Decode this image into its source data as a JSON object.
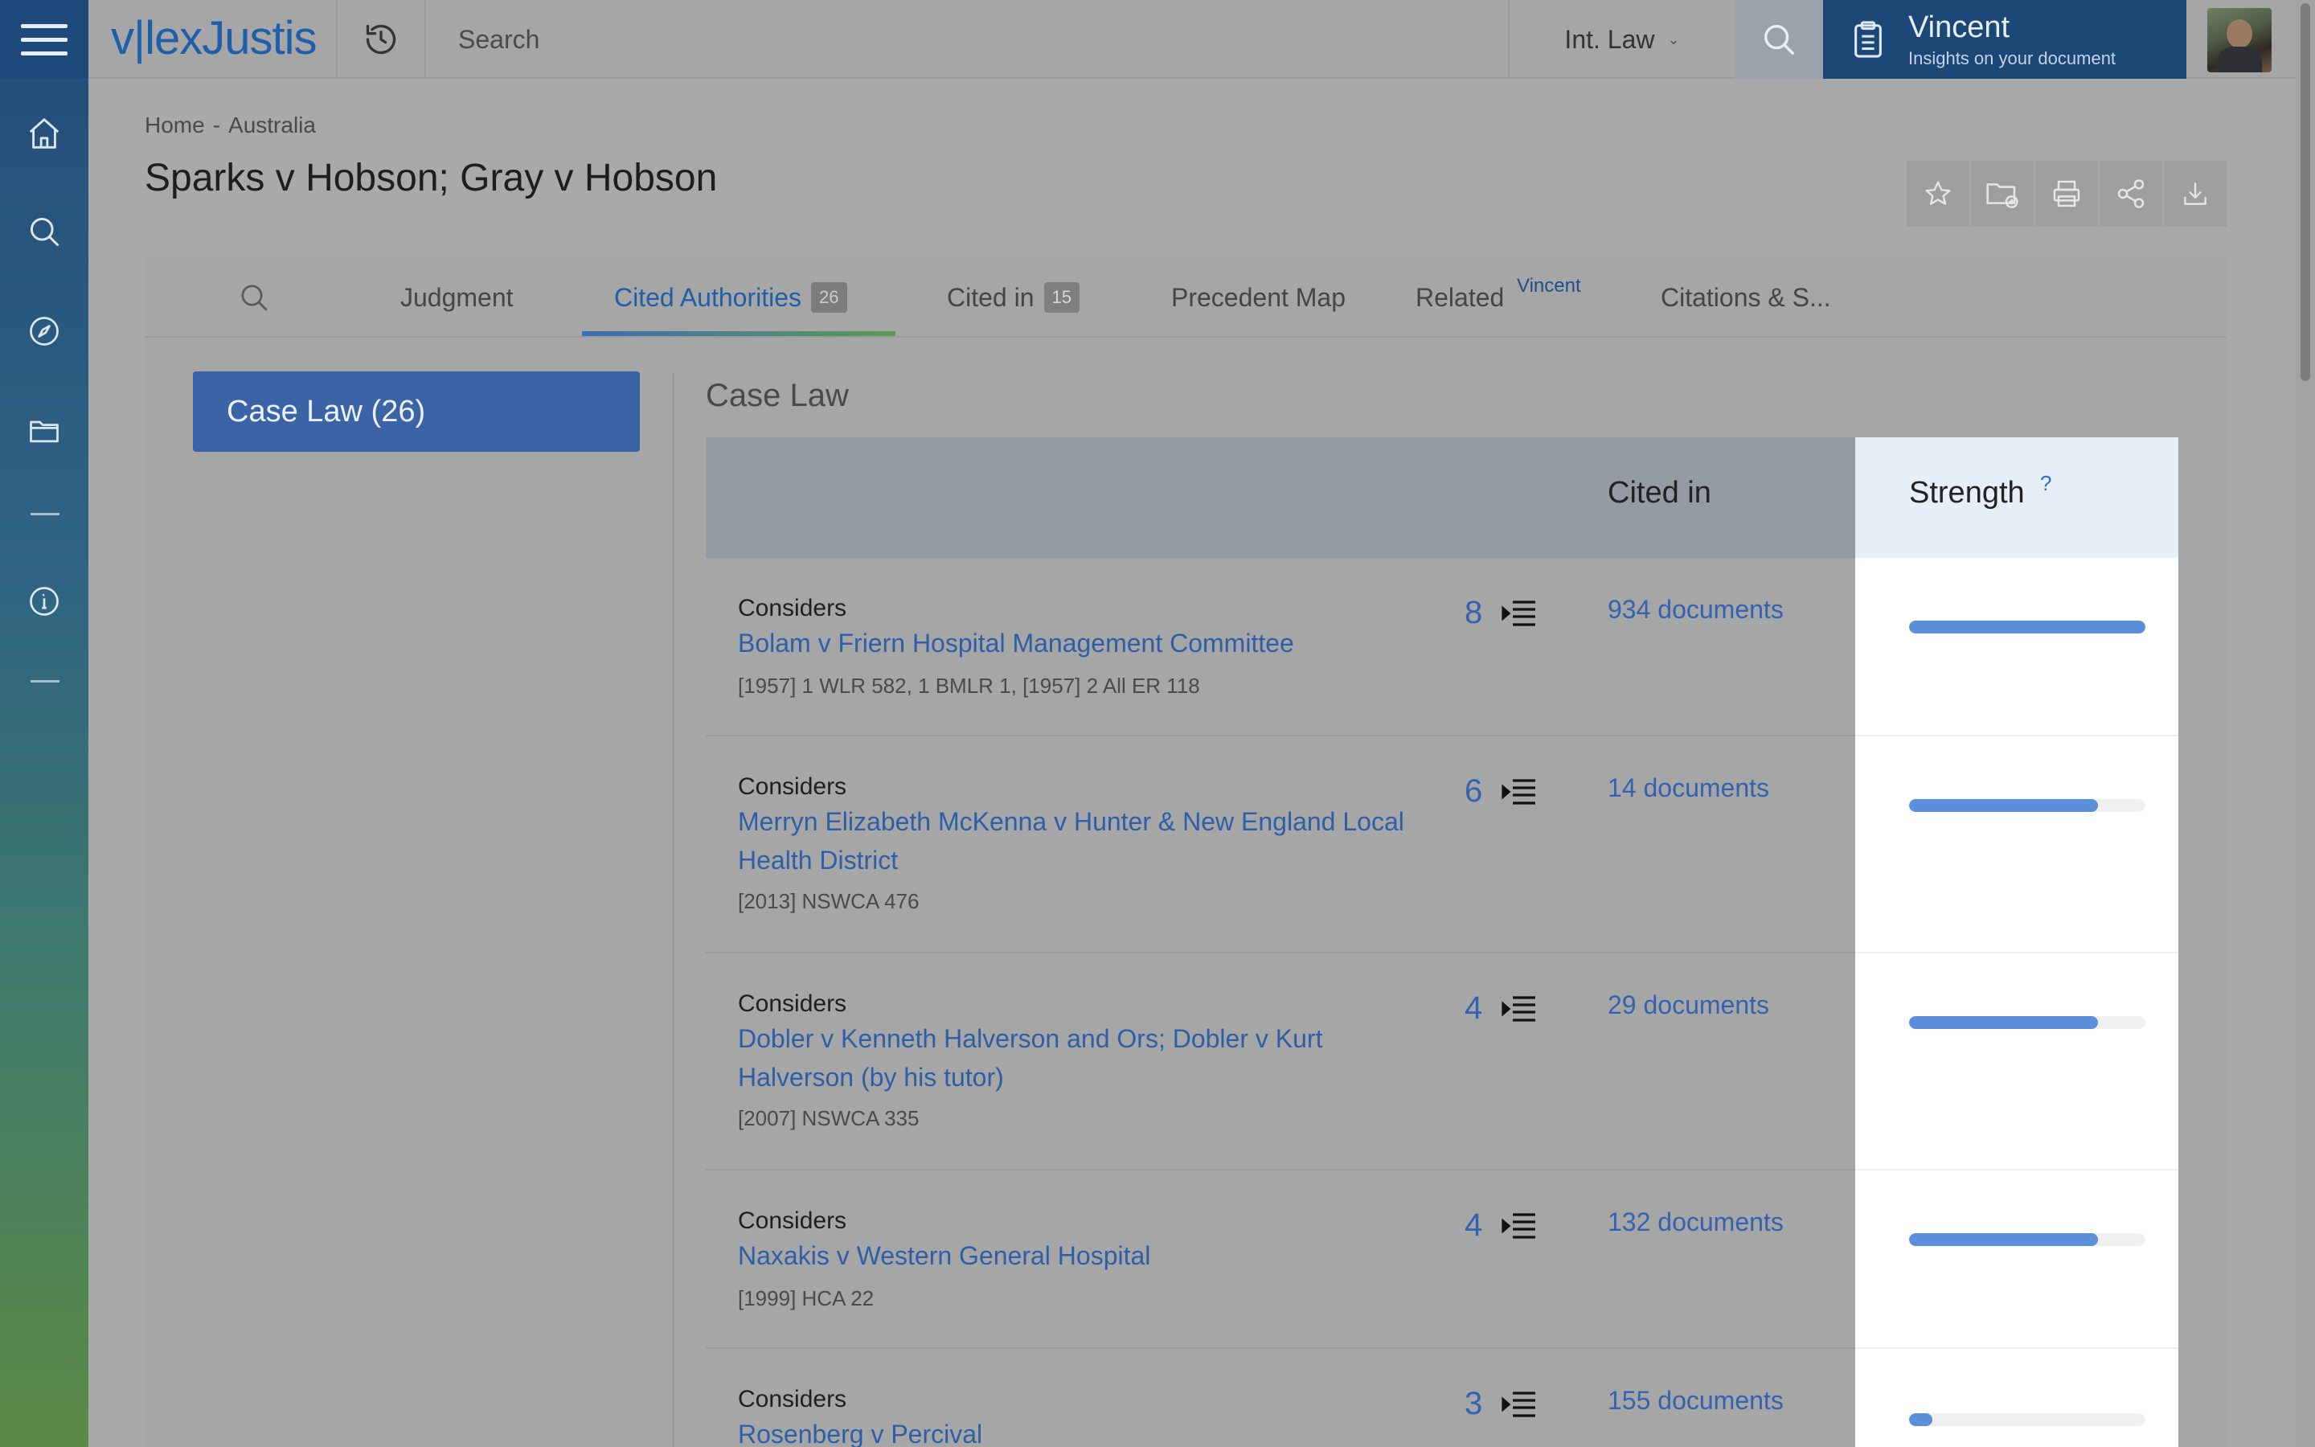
{
  "topbar": {
    "logo_v": "v",
    "logo_rest": "lexJustis",
    "search_placeholder": "Search",
    "jurisdiction": "Int. Law",
    "vincent_title": "Vincent",
    "vincent_subtitle": "Insights on your document"
  },
  "breadcrumb": [
    "Home",
    "-",
    "Australia"
  ],
  "page_title": "Sparks v Hobson; Gray v Hobson",
  "tabs": [
    {
      "label": "Judgment"
    },
    {
      "label": "Cited Authorities",
      "count": "26"
    },
    {
      "label": "Cited in",
      "count": "15"
    },
    {
      "label": "Precedent Map"
    },
    {
      "label": "Related",
      "sup": "Vincent"
    },
    {
      "label": "Citations & S..."
    }
  ],
  "filter": {
    "label": "Case Law (26)"
  },
  "section_title": "Case Law",
  "table": {
    "col_cited": "Cited in",
    "col_strength": "Strength",
    "strength_help": "?"
  },
  "rows": [
    {
      "type": "Considers",
      "name": "Bolam v Friern Hospital Management Committee",
      "ref": "[1957] 1 WLR 582, 1 BMLR 1, [1957] 2 All ER 118",
      "count": "8",
      "cited": "934 documents",
      "strength": 1.0
    },
    {
      "type": "Considers",
      "name": "Merryn Elizabeth McKenna v Hunter & New England Local Health District",
      "ref": "[2013] NSWCA 476",
      "count": "6",
      "cited": "14 documents",
      "strength": 0.8
    },
    {
      "type": "Considers",
      "name": "Dobler v Kenneth Halverson and Ors; Dobler v Kurt Halverson (by his tutor)",
      "ref": "[2007] NSWCA 335",
      "count": "4",
      "cited": "29 documents",
      "strength": 0.8
    },
    {
      "type": "Considers",
      "name": "Naxakis v Western General Hospital",
      "ref": "[1999] HCA 22",
      "count": "4",
      "cited": "132 documents",
      "strength": 0.8
    },
    {
      "type": "Considers",
      "name": "Rosenberg v Percival",
      "ref": "",
      "count": "3",
      "cited": "155 documents",
      "strength": 0.1
    }
  ]
}
